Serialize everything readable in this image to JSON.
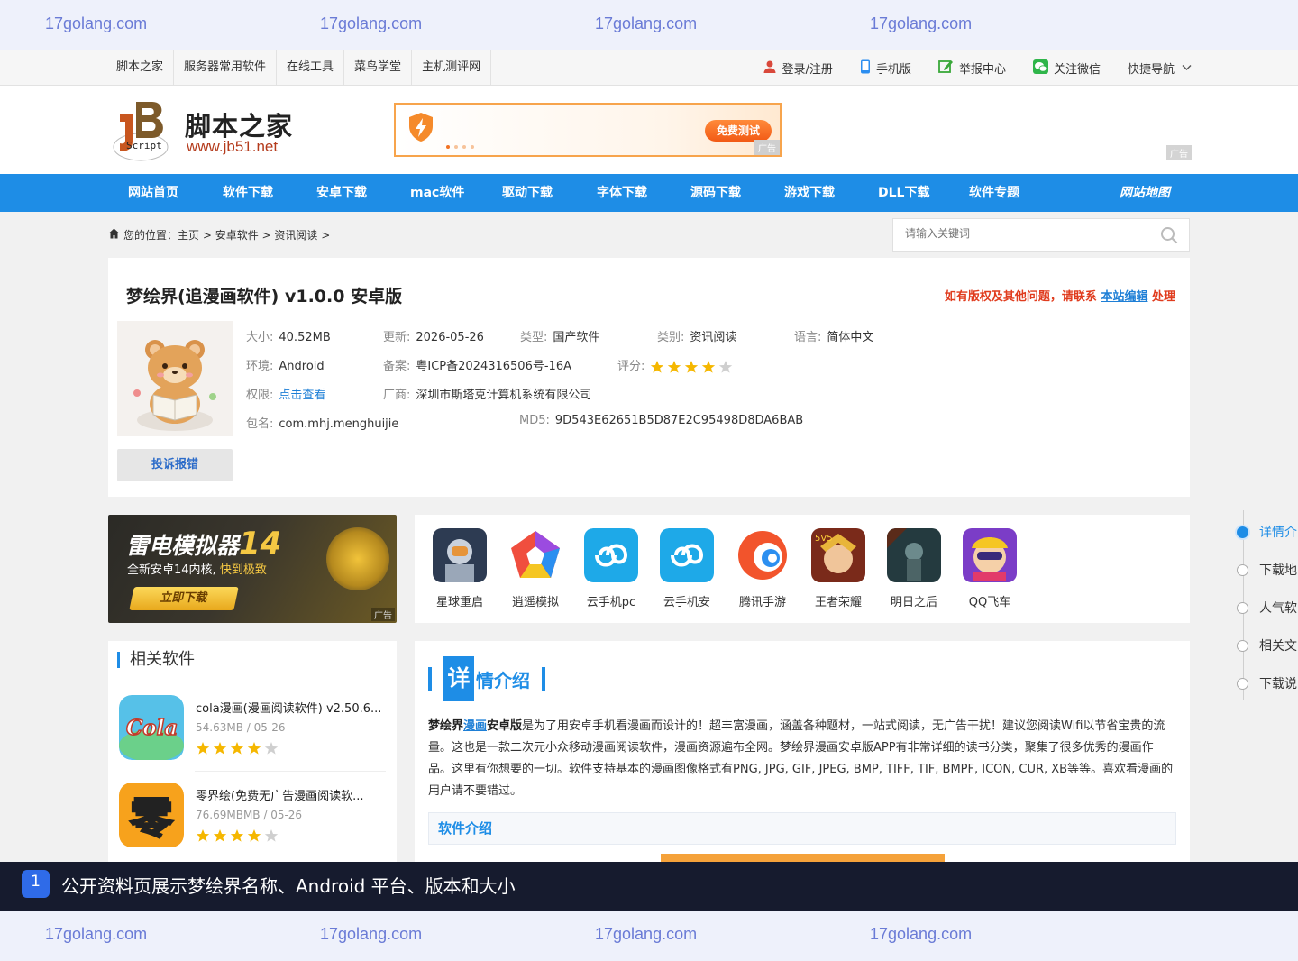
{
  "watermark": {
    "text": "17golang.com"
  },
  "topnav": {
    "links": [
      "脚本之家",
      "服务器常用软件",
      "在线工具",
      "菜鸟学堂",
      "主机测评网"
    ],
    "login": "登录/注册",
    "mobile": "手机版",
    "report": "举报中心",
    "wechat": "关注微信",
    "quicknav": "快捷导航"
  },
  "header": {
    "logo_cn": "脚本之家",
    "logo_url": "www.jb51.net",
    "logo_badge": "Script",
    "banner_btn": "免费测试",
    "ad_label": "广告"
  },
  "mainnav": {
    "items": [
      "网站首页",
      "软件下载",
      "安卓下载",
      "mac软件",
      "驱动下载",
      "字体下载",
      "源码下载",
      "游戏下载",
      "DLL下载",
      "软件专题"
    ],
    "sitemap": "网站地图"
  },
  "breadcrumb": {
    "prefix": "您的位置：",
    "path": "主页 > 安卓软件 > 资讯阅读 >"
  },
  "search": {
    "placeholder": "请输入关键词"
  },
  "app": {
    "title": "梦绘界(追漫画软件) v1.0.0 安卓版",
    "copyright_pre": "如有版权及其他问题，请联系",
    "copyright_link": "本站编辑",
    "copyright_post": "处理",
    "complain": "投诉报错",
    "fields": {
      "size_k": "大小:",
      "size_v": "40.52MB",
      "update_k": "更新:",
      "update_v": "2026-05-26",
      "type_k": "类型:",
      "type_v": "国产软件",
      "cat_k": "类别:",
      "cat_v": "资讯阅读",
      "lang_k": "语言:",
      "lang_v": "简体中文",
      "env_k": "环境:",
      "env_v": "Android",
      "icp_k": "备案:",
      "icp_v": "粤ICP备2024316506号-16A",
      "rate_k": "评分:",
      "perm_k": "权限:",
      "perm_v": "点击查看",
      "vendor_k": "厂商:",
      "vendor_v": "深圳市斯塔克计算机系统有限公司",
      "pkg_k": "包名:",
      "pkg_v": "com.mhj.menghuijie",
      "md5_k": "MD5:",
      "md5_v": "9D543E62651B5D87E2C95498D8DA6BAB"
    },
    "rating": 4
  },
  "leftad": {
    "title": "雷电模拟器",
    "num": "14",
    "sub_a": "全新安卓14内核,",
    "sub_b": "快到极致",
    "btn": "立即下载",
    "tag": "广告"
  },
  "apps": [
    {
      "name": "星球重启",
      "color": "#33455e"
    },
    {
      "name": "逍遥模拟",
      "color": "#ffffff"
    },
    {
      "name": "云手机pc",
      "color": "#1ea9e8"
    },
    {
      "name": "云手机安",
      "color": "#1ea9e8"
    },
    {
      "name": "腾讯手游",
      "color": "#ffffff"
    },
    {
      "name": "王者荣耀",
      "color": "#7a2a1a"
    },
    {
      "name": "明日之后",
      "color": "#2a3f44"
    },
    {
      "name": "QQ飞车",
      "color": "#7b3dc7"
    }
  ],
  "related": {
    "heading": "相关软件",
    "items": [
      {
        "name": "cola漫画(漫画阅读软件) v2.50.6...",
        "meta": "54.63MB / 05-26",
        "rating": 4
      },
      {
        "name": "零界绘(免费无广告漫画阅读软...",
        "meta": "76.69MBMB / 05-26",
        "rating": 4
      }
    ]
  },
  "detail": {
    "big_char": "详",
    "heading_rest": "情介绍",
    "p_name": "梦绘界",
    "p_link": "漫画",
    "p_ver": "安卓版",
    "p_text": "是为了用安卓手机看漫画而设计的！超丰富漫画，涵盖各种题材，一站式阅读，无广告干扰！建议您阅读Wifi以节省宝贵的流量。这也是一款二次元小众移动漫画阅读软件，漫画资源遍布全网。梦绘界漫画安卓版APP有非常详细的读书分类，聚集了很多优秀的漫画作品。这里有你想要的一切。软件支持基本的漫画图像格式有PNG, JPG, GIF, JPEG, BMP, TIFF, TIF, BMPF, ICON, CUR, XB等等。喜欢看漫画的用户请不要错过。",
    "sub_heading": "软件介绍"
  },
  "toc": [
    "详情介",
    "下载地",
    "人气软",
    "相关文",
    "下载说"
  ],
  "caption": {
    "num": "1",
    "text": "公开资料页展示梦绘界名称、Android 平台、版本和大小"
  },
  "colors": {
    "accent": "#1e8de6",
    "star": "#f5b700",
    "warn": "#e03c1e"
  }
}
